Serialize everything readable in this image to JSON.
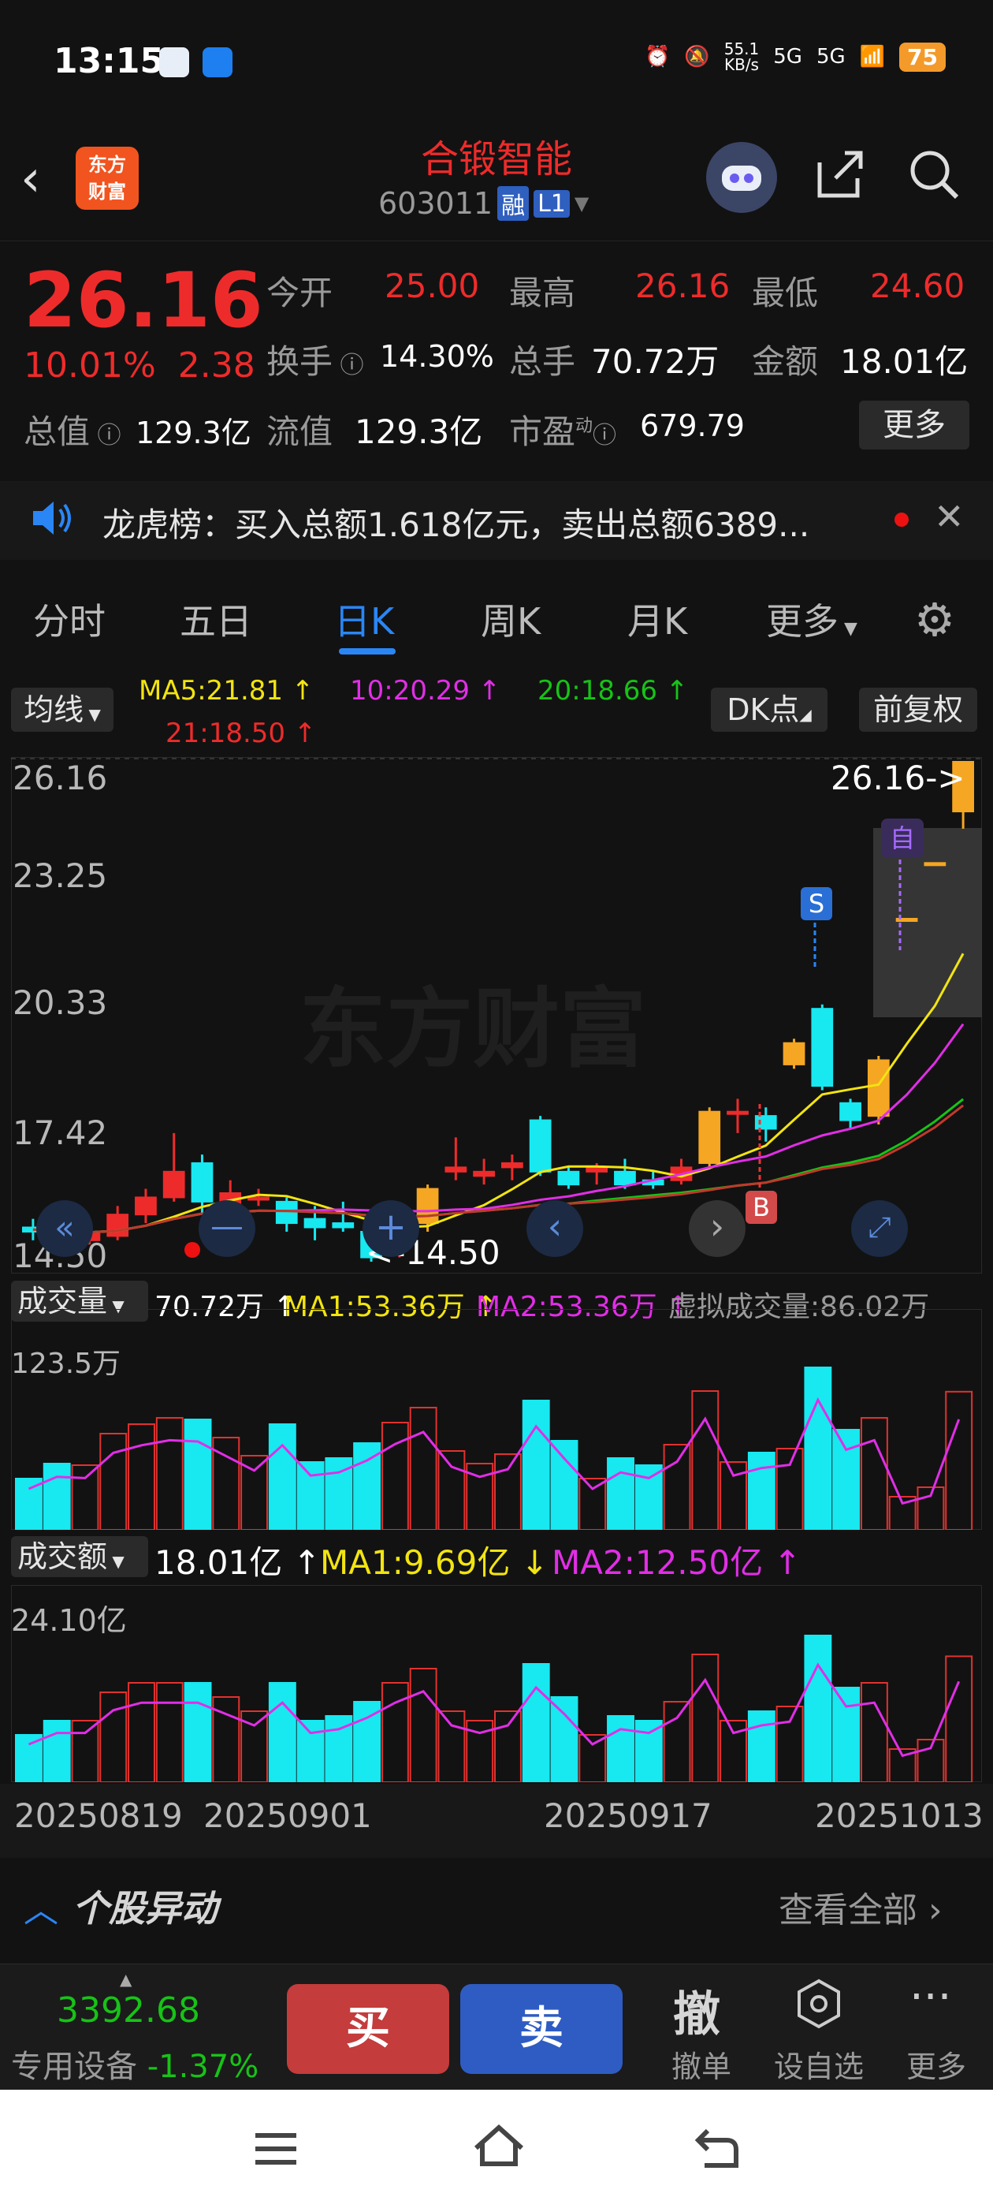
{
  "status": {
    "time": "13:15",
    "net_speed": "55.1",
    "net_unit": "KB/s",
    "signal1": "5G",
    "signal2": "5G",
    "battery": "75"
  },
  "header": {
    "stock_name": "合锻智能",
    "stock_code": "603011",
    "tag_margin": "融",
    "tag_level": "L1",
    "logo_line1": "东方",
    "logo_line2": "财富"
  },
  "quote": {
    "price": "26.16",
    "change_pct": "10.01%",
    "change_abs": "2.38",
    "open_label": "今开",
    "open": "25.00",
    "high_label": "最高",
    "high": "26.16",
    "low_label": "最低",
    "low": "24.60",
    "turnover_label": "换手",
    "turnover": "14.30%",
    "volume_label": "总手",
    "volume": "70.72万",
    "amount_label": "金额",
    "amount": "18.01亿",
    "mcap_label": "总值",
    "mcap": "129.3亿",
    "float_label": "流值",
    "float": "129.3亿",
    "pe_label": "市盈",
    "pe_sup": "动",
    "pe": "679.79",
    "more": "更多"
  },
  "ticker": {
    "text": "龙虎榜：买入总额1.618亿元，卖出总额6389..."
  },
  "tabs": [
    {
      "label": "分时"
    },
    {
      "label": "五日"
    },
    {
      "label": "日K"
    },
    {
      "label": "周K"
    },
    {
      "label": "月K"
    },
    {
      "label": "更多"
    }
  ],
  "ma_bar": {
    "selector": "均线",
    "ma5": "MA5:21.81 ↑",
    "ma10": "10:20.29 ↑",
    "ma20": "20:18.66 ↑",
    "ma21": "21:18.50 ↑",
    "dk": "DK点",
    "adjust": "前复权"
  },
  "kline": {
    "y_labels": [
      "26.16",
      "23.25",
      "20.33",
      "17.42",
      "14.50"
    ],
    "high_marker": "26.16->",
    "low_marker": "<-14.50",
    "s_label": "S",
    "b_label": "B",
    "self_label": "自",
    "watermark": "东方财富"
  },
  "volume_panel": {
    "label": "成交量",
    "value": "70.72万 ↑",
    "ma1": "MA1:53.36万 ↑",
    "ma2": "MA2:53.36万 ↑",
    "virtual": "虚拟成交量:86.02万",
    "top": "123.5万"
  },
  "amount_panel": {
    "label": "成交额",
    "value": "18.01亿 ↑",
    "ma1": "MA1:9.69亿 ↓",
    "ma2": "MA2:12.50亿 ↑",
    "top": "24.10亿"
  },
  "dates": [
    "20250819",
    "20250901",
    "20250917",
    "20251013"
  ],
  "anomaly": {
    "title": "个股异动",
    "link": "查看全部"
  },
  "bottom": {
    "index_value": "3392.68",
    "sector": "专用设备",
    "sector_chg": "-1.37%",
    "buy": "买",
    "sell": "卖",
    "cancel_icon": "撤",
    "cancel": "撤单",
    "watch": "设自选",
    "more": "更多"
  },
  "chart_data": {
    "type": "candlestick",
    "price_axis": [
      14.5,
      26.16
    ],
    "candles": [
      {
        "o": 15.3,
        "c": 15.2,
        "h": 15.5,
        "l": 15.0,
        "dir": "down"
      },
      {
        "o": 15.3,
        "c": 15.1,
        "h": 15.5,
        "l": 14.9,
        "dir": "down"
      },
      {
        "o": 15.0,
        "c": 15.2,
        "h": 15.3,
        "l": 14.9,
        "dir": "up"
      },
      {
        "o": 15.1,
        "c": 15.6,
        "h": 15.8,
        "l": 15.0,
        "dir": "up"
      },
      {
        "o": 15.6,
        "c": 16.0,
        "h": 16.2,
        "l": 15.4,
        "dir": "up"
      },
      {
        "o": 16.0,
        "c": 16.6,
        "h": 17.5,
        "l": 15.9,
        "dir": "up"
      },
      {
        "o": 16.8,
        "c": 15.9,
        "h": 17.0,
        "l": 15.6,
        "dir": "down"
      },
      {
        "o": 15.6,
        "c": 16.1,
        "h": 16.4,
        "l": 15.5,
        "dir": "up"
      },
      {
        "o": 16.0,
        "c": 16.0,
        "h": 16.2,
        "l": 15.8,
        "dir": "up"
      },
      {
        "o": 15.9,
        "c": 15.4,
        "h": 16.0,
        "l": 15.2,
        "dir": "down"
      },
      {
        "o": 15.5,
        "c": 15.3,
        "h": 15.8,
        "l": 15.0,
        "dir": "down"
      },
      {
        "o": 15.4,
        "c": 15.3,
        "h": 15.9,
        "l": 15.2,
        "dir": "down"
      },
      {
        "o": 15.2,
        "c": 14.6,
        "h": 15.3,
        "l": 14.5,
        "dir": "down"
      },
      {
        "o": 14.9,
        "c": 15.5,
        "h": 15.6,
        "l": 14.6,
        "dir": "up"
      },
      {
        "o": 15.4,
        "c": 16.2,
        "h": 16.3,
        "l": 15.2,
        "dir": "upY"
      },
      {
        "o": 16.6,
        "c": 16.7,
        "h": 17.4,
        "l": 16.4,
        "dir": "up"
      },
      {
        "o": 16.5,
        "c": 16.6,
        "h": 16.9,
        "l": 16.3,
        "dir": "up"
      },
      {
        "o": 16.7,
        "c": 16.8,
        "h": 17.0,
        "l": 16.4,
        "dir": "up"
      },
      {
        "o": 16.6,
        "c": 17.8,
        "h": 17.9,
        "l": 16.5,
        "dir": "down"
      },
      {
        "o": 16.6,
        "c": 16.3,
        "h": 16.7,
        "l": 16.2,
        "dir": "down"
      },
      {
        "o": 16.7,
        "c": 16.6,
        "h": 16.8,
        "l": 16.3,
        "dir": "up"
      },
      {
        "o": 16.6,
        "c": 16.3,
        "h": 16.9,
        "l": 16.2,
        "dir": "down"
      },
      {
        "o": 16.3,
        "c": 16.4,
        "h": 16.6,
        "l": 16.2,
        "dir": "down"
      },
      {
        "o": 16.4,
        "c": 16.7,
        "h": 16.9,
        "l": 16.3,
        "dir": "up"
      },
      {
        "o": 16.8,
        "c": 18.0,
        "h": 18.1,
        "l": 16.7,
        "dir": "upY"
      },
      {
        "o": 18.0,
        "c": 18.0,
        "h": 18.3,
        "l": 17.5,
        "dir": "up"
      },
      {
        "o": 17.9,
        "c": 17.6,
        "h": 18.1,
        "l": 17.3,
        "dir": "down"
      },
      {
        "o": 19.1,
        "c": 19.6,
        "h": 19.7,
        "l": 19.0,
        "dir": "upY"
      },
      {
        "o": 18.6,
        "c": 20.4,
        "h": 20.5,
        "l": 18.5,
        "dir": "down"
      },
      {
        "o": 18.2,
        "c": 17.8,
        "h": 18.3,
        "l": 17.6,
        "dir": "down"
      },
      {
        "o": 17.9,
        "c": 19.2,
        "h": 19.3,
        "l": 17.7,
        "dir": "upY"
      },
      {
        "o": 22.5,
        "c": 22.5,
        "h": 22.5,
        "l": 22.5,
        "dir": "flat"
      },
      {
        "o": 23.8,
        "c": 23.8,
        "h": 23.8,
        "l": 23.8,
        "dir": "flat"
      },
      {
        "o": 25.0,
        "c": 26.16,
        "h": 26.16,
        "l": 24.6,
        "dir": "upY"
      }
    ]
  }
}
